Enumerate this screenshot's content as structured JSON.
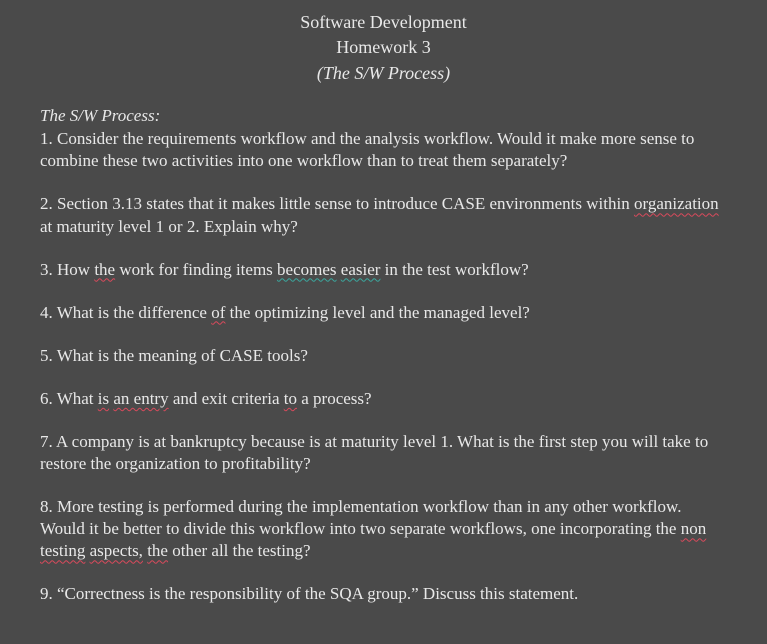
{
  "header": {
    "title": "Software Development",
    "subtitle": "Homework 3",
    "sub_italic": "(The S/W Process)"
  },
  "section_heading": "The S/W Process:",
  "questions": {
    "q1": "1. Consider the requirements workflow and the analysis workflow. Would it make more sense to combine these two activities into one workflow than to treat them separately?",
    "q2_a": "2. Section 3.13 states that it makes little sense to introduce CASE environments within ",
    "q2_org": "organization",
    "q2_b": " at maturity level 1 or 2. Explain why?",
    "q3_a": "3. How ",
    "q3_the": "the",
    "q3_b": " work for finding items ",
    "q3_becomes": "becomes",
    "q3_sp": " ",
    "q3_easier": "easier",
    "q3_c": " in the test workflow?",
    "q4_a": "4. What is the difference ",
    "q4_of": "of",
    "q4_b": " the optimizing level and the managed level?",
    "q5": "5. What is the meaning of CASE tools?",
    "q6_a": "6. What ",
    "q6_is": "is",
    "q6_sp1": " ",
    "q6_anentry": "an entry",
    "q6_b": " and exit criteria ",
    "q6_to": "to",
    "q6_c": " a process?",
    "q7": "7. A company is at bankruptcy because is at maturity level 1. What is the first step you will take to restore the organization to profitability?",
    "q8_a": "8. More testing is performed during the implementation workflow than in any other workflow. Would it be better to divide this workflow into two separate workflows, one incorporating the ",
    "q8_nontesting": "non testing",
    "q8_sp1": " ",
    "q8_aspects": "aspects,",
    "q8_sp2": " ",
    "q8_the": "the",
    "q8_b": " other all the testing?",
    "q9": "9. “Correctness is the responsibility of the SQA group.” Discuss this statement."
  }
}
